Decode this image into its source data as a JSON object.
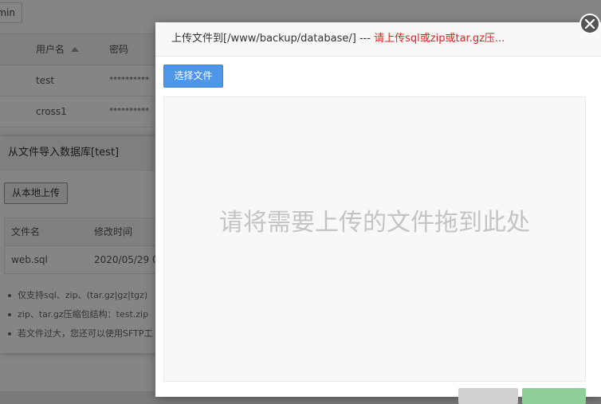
{
  "background": {
    "top_button_label": "min",
    "table": {
      "headers": {
        "username": "用户名",
        "password": "密码"
      },
      "rows": [
        {
          "username": "test",
          "password": "**********"
        },
        {
          "username": "cross1",
          "password": "**********"
        }
      ]
    },
    "import_dialog": {
      "title": "从文件导入数据库[test]",
      "upload_button": "从本地上传",
      "table": {
        "headers": {
          "filename": "文件名",
          "mtime": "修改时间"
        },
        "rows": [
          {
            "filename": "web.sql",
            "mtime": "2020/05/29 0"
          }
        ]
      },
      "notes": [
        "仅支持sql、zip、(tar.gz|gz|tgz)",
        "zip、tar.gz压缩包结构：test.zip",
        "若文件过大，您还可以使用SFTP工"
      ]
    }
  },
  "upload_modal": {
    "title_prefix": "上传文件到[/www/backup/database/] --- ",
    "title_warning": "请上传sql或zip或tar.gz压...",
    "choose_file_button": "选择文件",
    "dropzone_text": "请将需要上传的文件拖到此处",
    "close_icon": "close-icon",
    "colors": {
      "primary": "#4f95e8",
      "warning": "#e02020",
      "dropzone_bg": "#f7f8fa"
    }
  }
}
